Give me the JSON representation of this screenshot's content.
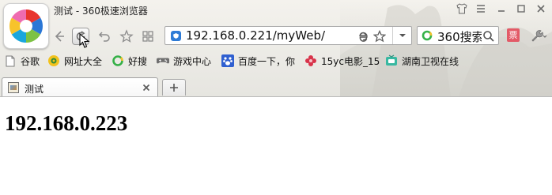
{
  "window": {
    "title": "测试 - 360极速浏览器"
  },
  "toolbar": {
    "buttons": [
      "back-icon",
      "refresh-icon",
      "undo-icon",
      "favorite-icon",
      "apps-icon"
    ],
    "address": {
      "url": "192.168.0.221/myWeb/",
      "icons": [
        "security-shield-icon",
        "ie-mode-icon",
        "star-icon",
        "dropdown-icon"
      ]
    },
    "search": {
      "text": "360搜索",
      "icons": [
        "360-search-icon",
        "search-icon"
      ]
    },
    "ticket_label": "票",
    "tools_icon": "wrench-icon"
  },
  "bookmarks": [
    {
      "label": "谷歌",
      "icon": "page-icon"
    },
    {
      "label": "网址大全",
      "icon": "globe-icon"
    },
    {
      "label": "好搜",
      "icon": "search-ring-icon"
    },
    {
      "label": "游戏中心",
      "icon": "gamepad-icon"
    },
    {
      "label": "百度一下，你",
      "icon": "paw-icon"
    },
    {
      "label": "15yc电影_15",
      "icon": "flower-icon"
    },
    {
      "label": "湖南卫视在线",
      "icon": "tv-icon"
    }
  ],
  "tabs": [
    {
      "label": "测试",
      "active": true
    }
  ],
  "content": {
    "heading": "192.168.0.223"
  },
  "colors": {
    "chrome": "#ecebe6",
    "accent_blue": "#2e7bd6",
    "ticket_red": "#e35a67"
  }
}
